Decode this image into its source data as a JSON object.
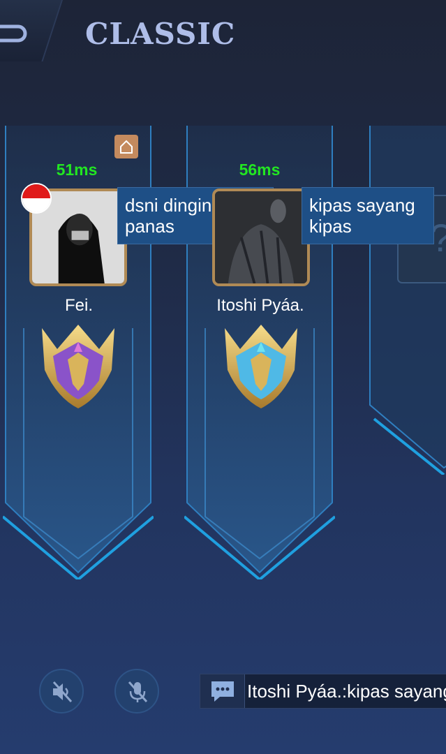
{
  "header": {
    "title": "CLASSIC",
    "back_icon": "back-arrow-icon"
  },
  "players": [
    {
      "name": "Fei.",
      "ping": "51ms",
      "chat_bubble": "dsni dingin dstu panas",
      "rank_icon": "mythic-rank-badge-purple",
      "flag": "indonesia-flag-icon",
      "home_icon": "home-icon"
    },
    {
      "name": "Itoshi Pyáa.",
      "ping": "56ms",
      "chat_bubble": "kipas sayang kipas",
      "rank_icon": "mythic-rank-badge-blue"
    }
  ],
  "controls": {
    "speaker_icon": "speaker-muted-icon",
    "mic_icon": "microphone-muted-icon"
  },
  "chat": {
    "icon": "chat-bubble-icon",
    "last_message": "Itoshi Pyáa.:kipas sayang"
  },
  "colors": {
    "ping": "#22e622",
    "title": "#aebde8",
    "bubble": "#1e4f86",
    "avatar_border": "#b08a55"
  }
}
